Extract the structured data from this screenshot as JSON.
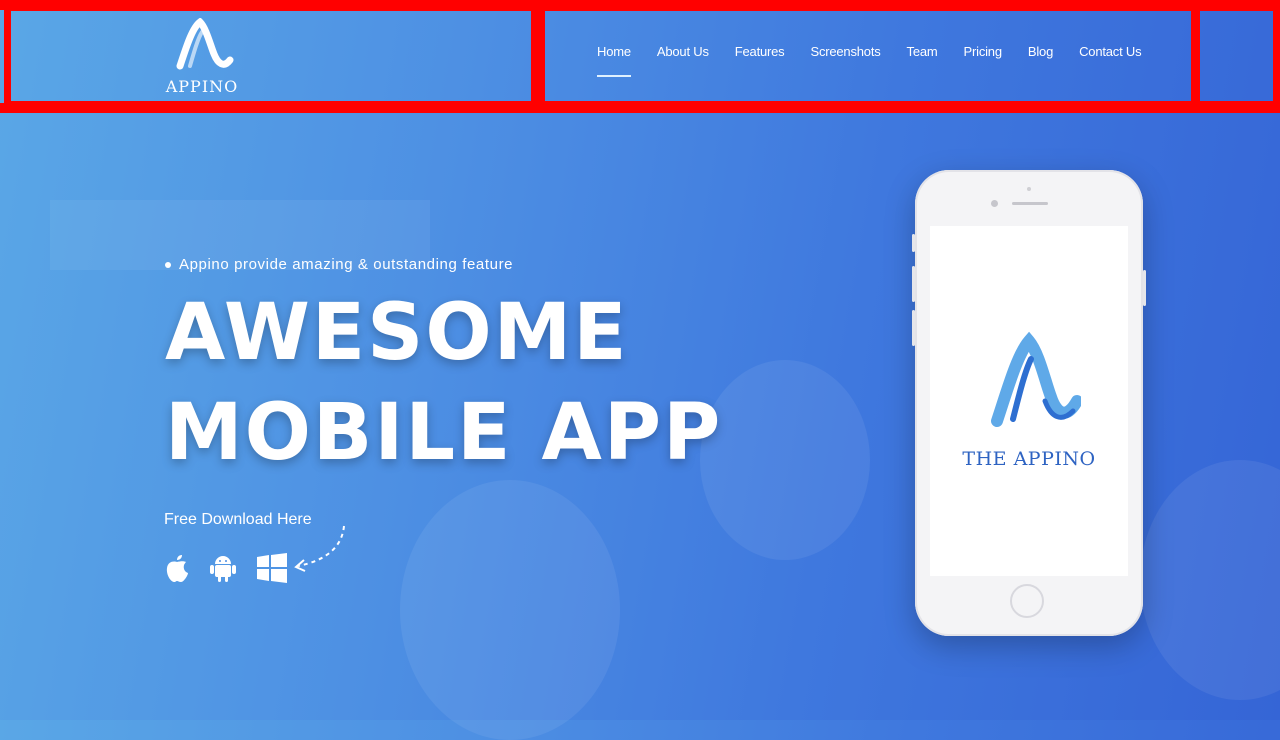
{
  "header": {
    "logo_text": "APPINO",
    "nav": [
      {
        "label": "Home",
        "active": true
      },
      {
        "label": "About Us"
      },
      {
        "label": "Features"
      },
      {
        "label": "Screenshots"
      },
      {
        "label": "Team"
      },
      {
        "label": "Pricing"
      },
      {
        "label": "Blog"
      },
      {
        "label": "Contact Us"
      }
    ]
  },
  "hero": {
    "tagline": "Appino provide amazing & outstanding feature",
    "headline_line1": "AWESOME",
    "headline_line2": "MOBILE APP",
    "download_label": "Free Download Here",
    "store_icons": [
      "apple-icon",
      "android-icon",
      "windows-icon"
    ]
  },
  "phone": {
    "screen_title": "THE APPINO"
  },
  "colors": {
    "highlight": "#ff0000",
    "bg_start": "#5aa7e6",
    "bg_end": "#3565d6",
    "brand_text": "#2e63c2"
  }
}
